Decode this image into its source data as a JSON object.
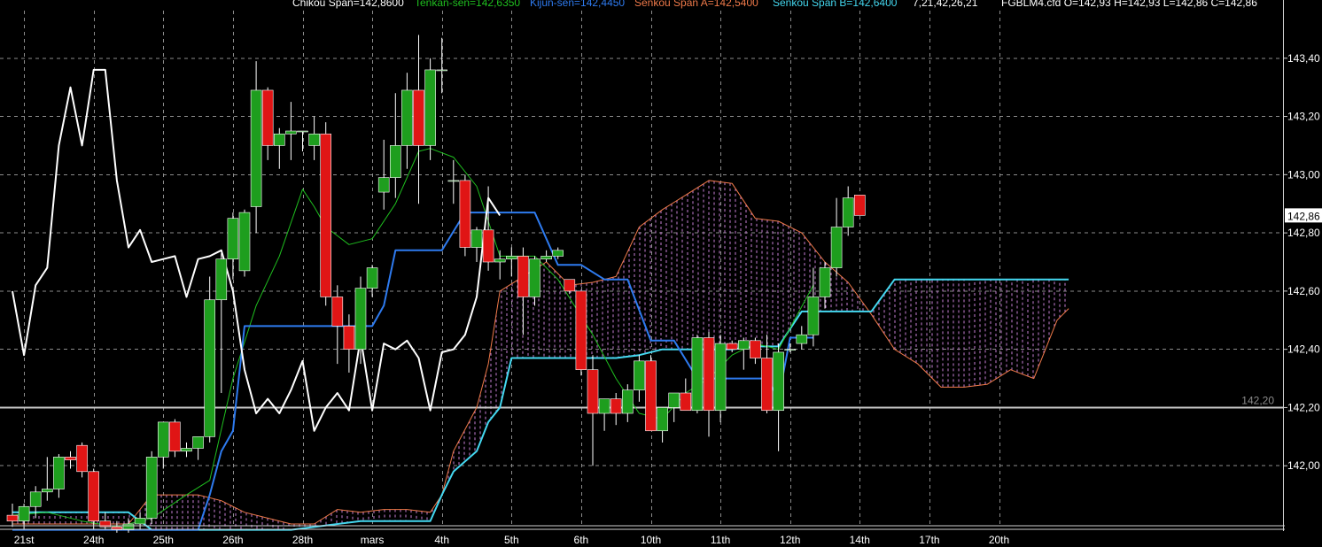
{
  "colors": {
    "background": "#000000",
    "grid": "#8c8c8c",
    "axis_text": "#ffffff",
    "bull": "#1e9e1e",
    "bear": "#e01515",
    "wick": "#ffffff",
    "chikou": "#ffffff",
    "tenkan": "#1fbf1f",
    "kijun": "#2e7bf0",
    "senkou_a": "#f07a4a",
    "senkou_b": "#44d8f0",
    "cloud_hatch": "#c77fd6",
    "hline": "#c8c8c8",
    "price_badge_bg": "#ffffff",
    "price_badge_text": "#000000"
  },
  "header": {
    "chikou": "Chikou Span=142,8600",
    "tenkan": "Tenkan-sen=142,6350",
    "kijun": "Kijun-sen=142,4450",
    "senkou_a": "Senkou Span A=142,5400",
    "senkou_b": "Senkou Span B=142,6400",
    "params": "7,21,42,26,21",
    "ohlc": "FGBLM4.cfd O=142,93 H=142,93 L=142,86 C=142,86"
  },
  "chart_data": {
    "type": "candlestick",
    "instrument": "FGBLM4.cfd",
    "indicator": "Ichimoku (7,21,42,26,21)",
    "ylim": [
      141.8,
      143.6
    ],
    "y_ticks": [
      "143,40",
      "143,20",
      "143,00",
      "142,80",
      "142,60",
      "142,40",
      "142,20",
      "142,00"
    ],
    "x_labels": [
      "21st",
      "24th",
      "25th",
      "26th",
      "28th",
      "mars",
      "4th",
      "5th",
      "6th",
      "10th",
      "11th",
      "12th",
      "14th",
      "17th",
      "20th"
    ],
    "x_label_index": [
      1,
      7,
      13,
      19,
      25,
      31,
      37,
      43,
      49,
      55,
      61,
      67,
      73,
      79,
      85
    ],
    "bar_count": 90,
    "last_bar": 68,
    "current_price": "142,86",
    "current_price_value": 142.86,
    "horizontal_line": {
      "value": 142.2,
      "label": "142,20"
    },
    "candles": [
      {
        "o": 141.83,
        "h": 141.87,
        "l": 141.79,
        "c": 141.81
      },
      {
        "o": 141.81,
        "h": 141.87,
        "l": 141.78,
        "c": 141.86
      },
      {
        "o": 141.86,
        "h": 141.93,
        "l": 141.82,
        "c": 141.91
      },
      {
        "o": 141.91,
        "h": 142.03,
        "l": 141.88,
        "c": 141.92
      },
      {
        "o": 141.92,
        "h": 142.04,
        "l": 141.89,
        "c": 142.03
      },
      {
        "o": 142.03,
        "h": 142.05,
        "l": 141.99,
        "c": 142.02
      },
      {
        "o": 142.07,
        "h": 142.08,
        "l": 141.96,
        "c": 141.98
      },
      {
        "o": 141.98,
        "h": 141.99,
        "l": 141.78,
        "c": 141.81
      },
      {
        "o": 141.81,
        "h": 141.84,
        "l": 141.78,
        "c": 141.79
      },
      {
        "o": 141.79,
        "h": 141.81,
        "l": 141.77,
        "c": 141.78
      },
      {
        "o": 141.78,
        "h": 141.82,
        "l": 141.77,
        "c": 141.8
      },
      {
        "o": 141.8,
        "h": 141.84,
        "l": 141.78,
        "c": 141.82
      },
      {
        "o": 141.82,
        "h": 142.05,
        "l": 141.8,
        "c": 142.03
      },
      {
        "o": 142.03,
        "h": 142.12,
        "l": 141.99,
        "c": 142.15
      },
      {
        "o": 142.15,
        "h": 142.16,
        "l": 142.03,
        "c": 142.05
      },
      {
        "o": 142.05,
        "h": 142.08,
        "l": 142.03,
        "c": 142.06
      },
      {
        "o": 142.06,
        "h": 142.1,
        "l": 142.02,
        "c": 142.1
      },
      {
        "o": 142.1,
        "h": 142.65,
        "l": 142.08,
        "c": 142.57
      },
      {
        "o": 142.57,
        "h": 142.73,
        "l": 142.25,
        "c": 142.71
      },
      {
        "o": 142.71,
        "h": 142.87,
        "l": 142.64,
        "c": 142.85
      },
      {
        "o": 142.67,
        "h": 142.88,
        "l": 142.65,
        "c": 142.87
      },
      {
        "o": 142.89,
        "h": 143.39,
        "l": 142.8,
        "c": 143.29
      },
      {
        "o": 143.29,
        "h": 143.3,
        "l": 143.05,
        "c": 143.1
      },
      {
        "o": 143.1,
        "h": 143.16,
        "l": 143.02,
        "c": 143.14
      },
      {
        "o": 143.14,
        "h": 143.25,
        "l": 143.05,
        "c": 143.15
      },
      {
        "o": 143.15,
        "h": 143.15,
        "l": 143.08,
        "c": 143.15
      },
      {
        "o": 143.1,
        "h": 143.2,
        "l": 143.05,
        "c": 143.14
      },
      {
        "o": 143.14,
        "h": 143.18,
        "l": 142.55,
        "c": 142.58
      },
      {
        "o": 142.58,
        "h": 142.62,
        "l": 142.35,
        "c": 142.48
      },
      {
        "o": 142.48,
        "h": 142.52,
        "l": 142.32,
        "c": 142.4
      },
      {
        "o": 142.4,
        "h": 142.65,
        "l": 142.35,
        "c": 142.61
      },
      {
        "o": 142.61,
        "h": 142.69,
        "l": 142.58,
        "c": 142.68
      },
      {
        "o": 142.94,
        "h": 143.12,
        "l": 142.88,
        "c": 142.99
      },
      {
        "o": 142.99,
        "h": 143.28,
        "l": 142.92,
        "c": 143.1
      },
      {
        "o": 143.1,
        "h": 143.35,
        "l": 143.02,
        "c": 143.29
      },
      {
        "o": 143.29,
        "h": 143.48,
        "l": 142.9,
        "c": 143.1
      },
      {
        "o": 143.1,
        "h": 143.4,
        "l": 143.05,
        "c": 143.36
      },
      {
        "o": 143.36,
        "h": 143.47,
        "l": 143.28,
        "c": 143.36
      },
      {
        "o": 142.98,
        "h": 143.05,
        "l": 142.9,
        "c": 142.98
      },
      {
        "o": 142.98,
        "h": 143.0,
        "l": 142.72,
        "c": 142.75
      },
      {
        "o": 142.75,
        "h": 142.82,
        "l": 142.7,
        "c": 142.81
      },
      {
        "o": 142.81,
        "h": 142.96,
        "l": 142.67,
        "c": 142.7
      },
      {
        "o": 142.7,
        "h": 142.74,
        "l": 142.64,
        "c": 142.71
      },
      {
        "o": 142.71,
        "h": 142.75,
        "l": 142.65,
        "c": 142.72
      },
      {
        "o": 142.72,
        "h": 142.75,
        "l": 142.45,
        "c": 142.58
      },
      {
        "o": 142.58,
        "h": 142.72,
        "l": 142.55,
        "c": 142.71
      },
      {
        "o": 142.71,
        "h": 142.74,
        "l": 142.7,
        "c": 142.72
      },
      {
        "o": 142.72,
        "h": 142.75,
        "l": 142.71,
        "c": 142.74
      },
      {
        "o": 142.64,
        "h": 142.64,
        "l": 142.59,
        "c": 142.6
      },
      {
        "o": 142.6,
        "h": 142.6,
        "l": 142.31,
        "c": 142.33
      },
      {
        "o": 142.33,
        "h": 142.38,
        "l": 142.0,
        "c": 142.18
      },
      {
        "o": 142.18,
        "h": 142.23,
        "l": 142.12,
        "c": 142.23
      },
      {
        "o": 142.23,
        "h": 142.25,
        "l": 142.14,
        "c": 142.18
      },
      {
        "o": 142.18,
        "h": 142.28,
        "l": 142.15,
        "c": 142.26
      },
      {
        "o": 142.26,
        "h": 142.38,
        "l": 142.22,
        "c": 142.36
      },
      {
        "o": 142.36,
        "h": 142.38,
        "l": 142.12,
        "c": 142.12
      },
      {
        "o": 142.12,
        "h": 142.2,
        "l": 142.08,
        "c": 142.2
      },
      {
        "o": 142.2,
        "h": 142.25,
        "l": 142.15,
        "c": 142.25
      },
      {
        "o": 142.25,
        "h": 142.3,
        "l": 142.19,
        "c": 142.19
      },
      {
        "o": 142.19,
        "h": 142.45,
        "l": 142.18,
        "c": 142.44
      },
      {
        "o": 142.44,
        "h": 142.46,
        "l": 142.1,
        "c": 142.19
      },
      {
        "o": 142.19,
        "h": 142.45,
        "l": 142.15,
        "c": 142.42
      },
      {
        "o": 142.42,
        "h": 142.43,
        "l": 142.39,
        "c": 142.4
      },
      {
        "o": 142.4,
        "h": 142.44,
        "l": 142.33,
        "c": 142.43
      },
      {
        "o": 142.43,
        "h": 142.44,
        "l": 142.35,
        "c": 142.37
      },
      {
        "o": 142.37,
        "h": 142.45,
        "l": 142.18,
        "c": 142.19
      },
      {
        "o": 142.19,
        "h": 142.42,
        "l": 142.05,
        "c": 142.39
      },
      {
        "o": 142.4,
        "h": 142.42,
        "l": 142.39,
        "c": 142.4
      },
      {
        "o": 142.42,
        "h": 142.48,
        "l": 142.4,
        "c": 142.45
      },
      {
        "o": 142.45,
        "h": 142.68,
        "l": 142.41,
        "c": 142.58
      },
      {
        "o": 142.58,
        "h": 142.7,
        "l": 142.54,
        "c": 142.68
      },
      {
        "o": 142.68,
        "h": 142.92,
        "l": 142.65,
        "c": 142.82
      },
      {
        "o": 142.82,
        "h": 142.96,
        "l": 142.79,
        "c": 142.92
      },
      {
        "o": 142.93,
        "h": 142.93,
        "l": 142.86,
        "c": 142.86
      }
    ],
    "series": [
      {
        "key": "chikou",
        "name": "Chikou Span",
        "x": [
          0,
          1,
          2,
          3,
          4,
          5,
          6,
          7,
          8,
          9,
          10,
          11,
          12,
          13,
          14,
          15,
          16,
          17,
          18,
          19,
          20,
          21,
          22,
          23,
          24,
          25,
          26,
          27,
          28,
          29,
          30,
          31,
          32,
          33,
          34,
          35,
          36,
          37,
          38,
          39,
          40,
          41,
          42
        ],
        "values": [
          142.6,
          142.38,
          142.62,
          142.68,
          143.1,
          143.3,
          143.1,
          143.36,
          143.36,
          142.98,
          142.75,
          142.81,
          142.7,
          142.71,
          142.72,
          142.58,
          142.71,
          142.72,
          142.74,
          142.6,
          142.33,
          142.18,
          142.23,
          142.18,
          142.26,
          142.36,
          142.12,
          142.2,
          142.25,
          142.19,
          142.44,
          142.19,
          142.42,
          142.4,
          142.43,
          142.37,
          142.19,
          142.39,
          142.4,
          142.45,
          142.58,
          142.92,
          142.86
        ]
      },
      {
        "key": "tenkan",
        "name": "Tenkan-sen",
        "x": [
          0,
          3,
          6,
          9,
          12,
          15,
          17,
          19,
          21,
          23,
          25,
          26,
          27,
          29,
          31,
          33,
          35,
          36,
          38,
          40,
          42,
          45,
          47,
          50,
          52,
          54,
          56,
          58,
          60,
          62,
          64,
          66,
          69
        ],
        "values": [
          141.83,
          141.84,
          141.81,
          141.79,
          141.82,
          141.9,
          141.95,
          142.3,
          142.55,
          142.72,
          142.95,
          142.89,
          142.82,
          142.76,
          142.78,
          142.9,
          143.08,
          143.09,
          143.06,
          142.96,
          142.72,
          142.72,
          142.64,
          142.45,
          142.3,
          142.18,
          142.16,
          142.25,
          142.3,
          142.38,
          142.42,
          142.4,
          142.62
        ]
      },
      {
        "key": "kijun",
        "name": "Kijun-sen",
        "x": [
          0,
          4,
          7,
          10,
          12,
          14,
          15,
          16,
          17,
          18,
          19,
          20,
          21,
          22,
          23,
          25,
          27,
          29,
          31,
          32,
          33,
          34,
          37,
          39,
          41,
          43,
          45,
          47,
          49,
          51,
          53,
          55,
          57,
          59,
          61,
          63,
          65,
          66,
          67,
          69
        ],
        "values": [
          141.78,
          141.78,
          141.78,
          141.78,
          141.78,
          141.78,
          141.78,
          141.78,
          141.9,
          142.05,
          142.12,
          142.48,
          142.48,
          142.48,
          142.48,
          142.48,
          142.48,
          142.48,
          142.48,
          142.55,
          142.74,
          142.74,
          142.74,
          142.87,
          142.87,
          142.87,
          142.87,
          142.69,
          142.69,
          142.64,
          142.64,
          142.43,
          142.43,
          142.3,
          142.3,
          142.3,
          142.3,
          142.23,
          142.44,
          142.44
        ]
      },
      {
        "key": "senkou_a",
        "name": "Senkou Span A",
        "x": [
          0,
          6,
          8,
          10,
          12,
          14,
          16,
          18,
          20,
          22,
          24,
          26,
          28,
          30,
          32,
          34,
          36,
          37,
          38,
          40,
          41,
          42,
          44,
          46,
          48,
          50,
          52,
          54,
          56,
          58,
          60,
          62,
          64,
          66,
          68,
          70,
          72,
          74,
          76,
          78,
          80,
          82,
          84,
          86,
          88,
          90,
          91
        ],
        "values": [
          141.8,
          141.8,
          141.8,
          141.8,
          141.9,
          141.9,
          141.9,
          141.88,
          141.84,
          141.82,
          141.8,
          141.8,
          141.85,
          141.84,
          141.85,
          141.85,
          141.84,
          141.9,
          142.05,
          142.2,
          142.35,
          142.6,
          142.65,
          142.7,
          142.62,
          142.63,
          142.65,
          142.82,
          142.88,
          142.93,
          142.98,
          142.97,
          142.85,
          142.84,
          142.8,
          142.7,
          142.63,
          142.52,
          142.4,
          142.35,
          142.27,
          142.27,
          142.28,
          142.33,
          142.3,
          142.5,
          142.54
        ]
      },
      {
        "key": "senkou_b",
        "name": "Senkou Span B",
        "x": [
          0,
          4,
          8,
          10,
          12,
          16,
          18,
          20,
          24,
          30,
          34,
          36,
          37,
          38,
          40,
          41,
          42,
          43,
          44,
          46,
          48,
          50,
          52,
          54,
          56,
          58,
          60,
          62,
          64,
          66,
          68,
          70,
          72,
          74,
          76,
          78,
          80,
          82,
          84,
          86,
          88,
          90,
          91
        ],
        "values": [
          141.84,
          141.84,
          141.84,
          141.84,
          141.78,
          141.78,
          141.78,
          141.78,
          141.78,
          141.81,
          141.81,
          141.81,
          141.9,
          141.98,
          142.05,
          142.15,
          142.2,
          142.37,
          142.37,
          142.37,
          142.37,
          142.37,
          142.37,
          142.38,
          142.4,
          142.4,
          142.4,
          142.4,
          142.41,
          142.41,
          142.53,
          142.53,
          142.53,
          142.53,
          142.64,
          142.64,
          142.64,
          142.64,
          142.64,
          142.64,
          142.64,
          142.64,
          142.64
        ]
      }
    ]
  }
}
